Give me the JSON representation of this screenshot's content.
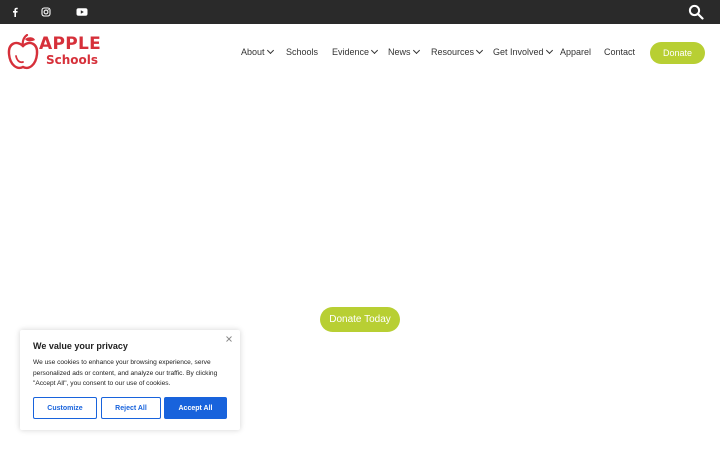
{
  "topbar": {
    "social_icons": [
      "facebook-icon",
      "instagram-icon",
      "youtube-icon"
    ],
    "search_icon": "search-icon"
  },
  "logo": {
    "line1": "APPLE",
    "line2": "Schools",
    "color": "#d6303a"
  },
  "nav": {
    "items": [
      {
        "label": "About",
        "dropdown": true
      },
      {
        "label": "Schools",
        "dropdown": false
      },
      {
        "label": "Evidence",
        "dropdown": true
      },
      {
        "label": "News",
        "dropdown": true
      },
      {
        "label": "Resources",
        "dropdown": true
      },
      {
        "label": "Get Involved",
        "dropdown": true
      },
      {
        "label": "Apparel",
        "dropdown": false
      },
      {
        "label": "Contact",
        "dropdown": false
      }
    ],
    "donate_label": "Donate"
  },
  "hero": {
    "donate_today_label": "Donate Today"
  },
  "cookie_banner": {
    "title": "We value your privacy",
    "text": "We use cookies to enhance your browsing experience, serve personalized ads or content, and analyze our traffic. By clicking \"Accept All\", you consent to our use of cookies.",
    "customize_label": "Customize",
    "reject_label": "Reject All",
    "accept_label": "Accept All"
  },
  "colors": {
    "accent": "#b8cf33",
    "topbar": "#2a2a2a",
    "cookie_button": "#1863dc"
  }
}
